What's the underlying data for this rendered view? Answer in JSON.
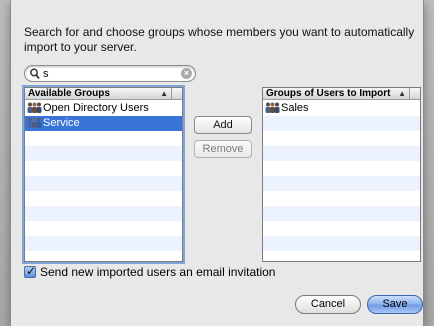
{
  "dialog": {
    "instructions": "Search for and choose groups whose members you want to automatically import to your server."
  },
  "search": {
    "value": "s",
    "clear_glyph": "×"
  },
  "available_groups": {
    "header": "Available Groups",
    "sort_glyph": "▲",
    "rows": [
      {
        "label": "Open Directory Users",
        "icon": "group-icon",
        "selected": false
      },
      {
        "label": "Service",
        "icon": "group-icon",
        "selected": true
      }
    ]
  },
  "import_groups": {
    "header": "Groups of Users to Import",
    "sort_glyph": "▲",
    "rows": [
      {
        "label": "Sales",
        "icon": "group-icon",
        "selected": false
      }
    ]
  },
  "buttons": {
    "add": "Add",
    "remove": "Remove",
    "cancel": "Cancel",
    "save": "Save"
  },
  "invite": {
    "checked": true,
    "label": "Send new imported users an email invitation"
  },
  "colors": {
    "selection": "#3875d7",
    "default_button": "#6f9ae3",
    "row_stripe": "#edf3fe"
  }
}
